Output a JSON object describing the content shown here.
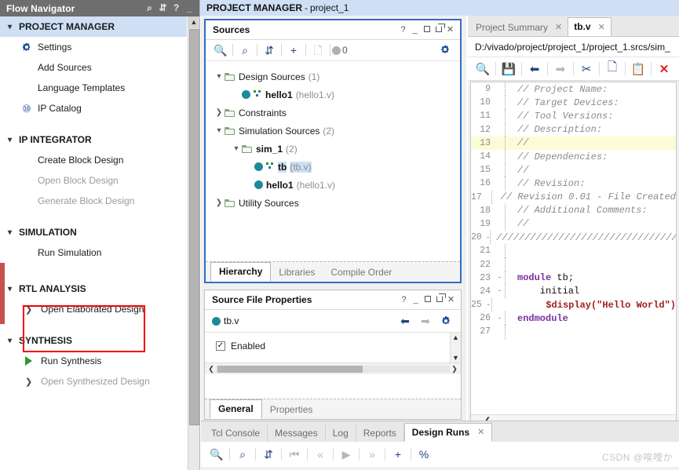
{
  "flow_navigator": {
    "title": "Flow Navigator",
    "header_icons": [
      "collapse-all-icon",
      "expand-collapse-icon",
      "help-icon",
      "minimize-icon"
    ],
    "sections": [
      {
        "label": "PROJECT MANAGER",
        "selected": true,
        "items": [
          {
            "label": "Settings",
            "icon": "gear-icon",
            "disabled": false
          },
          {
            "label": "Add Sources",
            "icon": "none",
            "disabled": false
          },
          {
            "label": "Language Templates",
            "icon": "none",
            "disabled": false
          },
          {
            "label": "IP Catalog",
            "icon": "ip-icon",
            "disabled": false
          }
        ]
      },
      {
        "label": "IP INTEGRATOR",
        "selected": false,
        "items": [
          {
            "label": "Create Block Design",
            "icon": "none",
            "disabled": false
          },
          {
            "label": "Open Block Design",
            "icon": "none",
            "disabled": true
          },
          {
            "label": "Generate Block Design",
            "icon": "none",
            "disabled": true
          }
        ]
      },
      {
        "label": "SIMULATION",
        "selected": false,
        "items": [
          {
            "label": "Run Simulation",
            "icon": "none",
            "disabled": false,
            "highlighted": true
          }
        ]
      },
      {
        "label": "RTL ANALYSIS",
        "selected": false,
        "items": [
          {
            "label": "Open Elaborated Design",
            "icon": "chevron-right-icon",
            "disabled": false
          }
        ]
      },
      {
        "label": "SYNTHESIS",
        "selected": false,
        "items": [
          {
            "label": "Run Synthesis",
            "icon": "play-icon",
            "disabled": false
          },
          {
            "label": "Open Synthesized Design",
            "icon": "chevron-right-icon",
            "disabled": true
          }
        ]
      }
    ]
  },
  "project_title": {
    "mode": "PROJECT MANAGER",
    "dash": "-",
    "name": "project_1"
  },
  "sources_panel": {
    "title": "Sources",
    "header_buttons": [
      "help-icon",
      "minimize-icon",
      "maximize-icon",
      "float-icon",
      "close-icon"
    ],
    "toolbar": {
      "search": "search-icon",
      "collapse_all": "collapse-all-icon",
      "expand_all": "expand-all-icon",
      "add": "plus-icon",
      "report": "report-icon",
      "status_count": "0",
      "settings": "gear-icon"
    },
    "tree": [
      {
        "depth": 0,
        "arrow": "down",
        "icon": "folder",
        "name": "Design Sources",
        "count": "(1)"
      },
      {
        "depth": 1,
        "arrow": "none",
        "icon": "module",
        "name": "hello1",
        "sub": "(hello1.v)"
      },
      {
        "depth": 0,
        "arrow": "right",
        "icon": "folder",
        "name": "Constraints",
        "count": ""
      },
      {
        "depth": 0,
        "arrow": "down",
        "icon": "folder",
        "name": "Simulation Sources",
        "count": "(2)"
      },
      {
        "depth": 1,
        "arrow": "down",
        "icon": "folder",
        "name": "sim_1",
        "count": "(2)"
      },
      {
        "depth": 2,
        "arrow": "none",
        "icon": "module",
        "name": "tb",
        "sub": "(tb.v)",
        "selected": true
      },
      {
        "depth": 2,
        "arrow": "none",
        "icon": "dot",
        "name": "hello1",
        "sub": "(hello1.v)"
      },
      {
        "depth": 0,
        "arrow": "right",
        "icon": "folder",
        "name": "Utility Sources",
        "count": ""
      }
    ],
    "tabs": [
      {
        "label": "Hierarchy",
        "active": true
      },
      {
        "label": "Libraries",
        "active": false
      },
      {
        "label": "Compile Order",
        "active": false
      }
    ]
  },
  "source_file_properties": {
    "title": "Source File Properties",
    "header_buttons": [
      "help-icon",
      "minimize-icon",
      "maximize-icon",
      "float-icon",
      "close-icon"
    ],
    "file_name": "tb.v",
    "nav_back": "back-arrow-icon",
    "nav_forward": "forward-arrow-icon",
    "settings": "gear-icon",
    "enabled_label": "Enabled",
    "enabled_checked": true,
    "tabs": [
      {
        "label": "General",
        "active": true
      },
      {
        "label": "Properties",
        "active": false
      }
    ]
  },
  "editor": {
    "tabs": [
      {
        "label": "Project Summary",
        "active": false,
        "close": "×"
      },
      {
        "label": "tb.v",
        "active": true,
        "close": "×"
      }
    ],
    "path": "D:/vivado/project/project_1/project_1.srcs/sim_",
    "toolbar": [
      "search-icon",
      "save-icon",
      "undo-icon",
      "redo-icon",
      "cut-icon",
      "copy-icon",
      "paste-icon",
      "delete-icon"
    ],
    "lines": [
      {
        "num": "9",
        "fold": "",
        "text": "// Project Name:",
        "style": "comment"
      },
      {
        "num": "10",
        "fold": "",
        "text": "// Target Devices:",
        "style": "comment"
      },
      {
        "num": "11",
        "fold": "",
        "text": "// Tool Versions:",
        "style": "comment"
      },
      {
        "num": "12",
        "fold": "",
        "text": "// Description:",
        "style": "comment"
      },
      {
        "num": "13",
        "fold": "",
        "text": "//",
        "style": "comment",
        "highlight": true
      },
      {
        "num": "14",
        "fold": "",
        "text": "// Dependencies:",
        "style": "comment"
      },
      {
        "num": "15",
        "fold": "",
        "text": "//",
        "style": "comment"
      },
      {
        "num": "16",
        "fold": "",
        "text": "// Revision:",
        "style": "comment"
      },
      {
        "num": "17",
        "fold": "",
        "text": "// Revision 0.01 - File Created",
        "style": "comment"
      },
      {
        "num": "18",
        "fold": "",
        "text": "// Additional Comments:",
        "style": "comment"
      },
      {
        "num": "19",
        "fold": "",
        "text": "//",
        "style": "comment"
      },
      {
        "num": "20",
        "fold": "-",
        "text": "//////////////////////////////////",
        "style": "comment"
      },
      {
        "num": "21",
        "fold": "",
        "text": "",
        "style": "plain"
      },
      {
        "num": "22",
        "fold": "",
        "text": "",
        "style": "plain"
      },
      {
        "num": "23",
        "fold": "-",
        "text": "module tb;",
        "style": "module"
      },
      {
        "num": "24",
        "fold": "-",
        "text": "    initial",
        "style": "initial"
      },
      {
        "num": "25",
        "fold": "-",
        "text": "        $display(\"Hello World\")",
        "style": "display"
      },
      {
        "num": "26",
        "fold": "-",
        "text": "endmodule",
        "style": "endmodule"
      },
      {
        "num": "27",
        "fold": "",
        "text": "",
        "style": "plain"
      }
    ],
    "code_tokens": {
      "module_kw": "module",
      "module_name": " tb;",
      "initial_kw": "    initial",
      "display_indent": "        ",
      "display_fn": "$display(",
      "display_str": "\"Hello World\"",
      "display_end": ")",
      "endmodule_kw": "endmodule"
    }
  },
  "bottom_panel": {
    "tabs": [
      {
        "label": "Tcl Console",
        "active": false
      },
      {
        "label": "Messages",
        "active": false
      },
      {
        "label": "Log",
        "active": false
      },
      {
        "label": "Reports",
        "active": false
      },
      {
        "label": "Design Runs",
        "active": true,
        "close": "×"
      }
    ],
    "toolbar": [
      "search-icon",
      "collapse-all-icon",
      "expand-all-icon",
      "first-icon",
      "prev-icon",
      "play-icon",
      "next-icon",
      "plus-icon",
      "percent-icon"
    ]
  },
  "watermark": "CSDN @唉哩か",
  "colors": {
    "header_gray": "#6e6e6e",
    "selection_blue": "#cfdff5",
    "focus_border": "#2f6ec4",
    "highlight_red": "#f50000",
    "accent_blue": "#22437f",
    "module_teal": "#1d8a9b",
    "line_highlight": "#fcfbd8"
  }
}
